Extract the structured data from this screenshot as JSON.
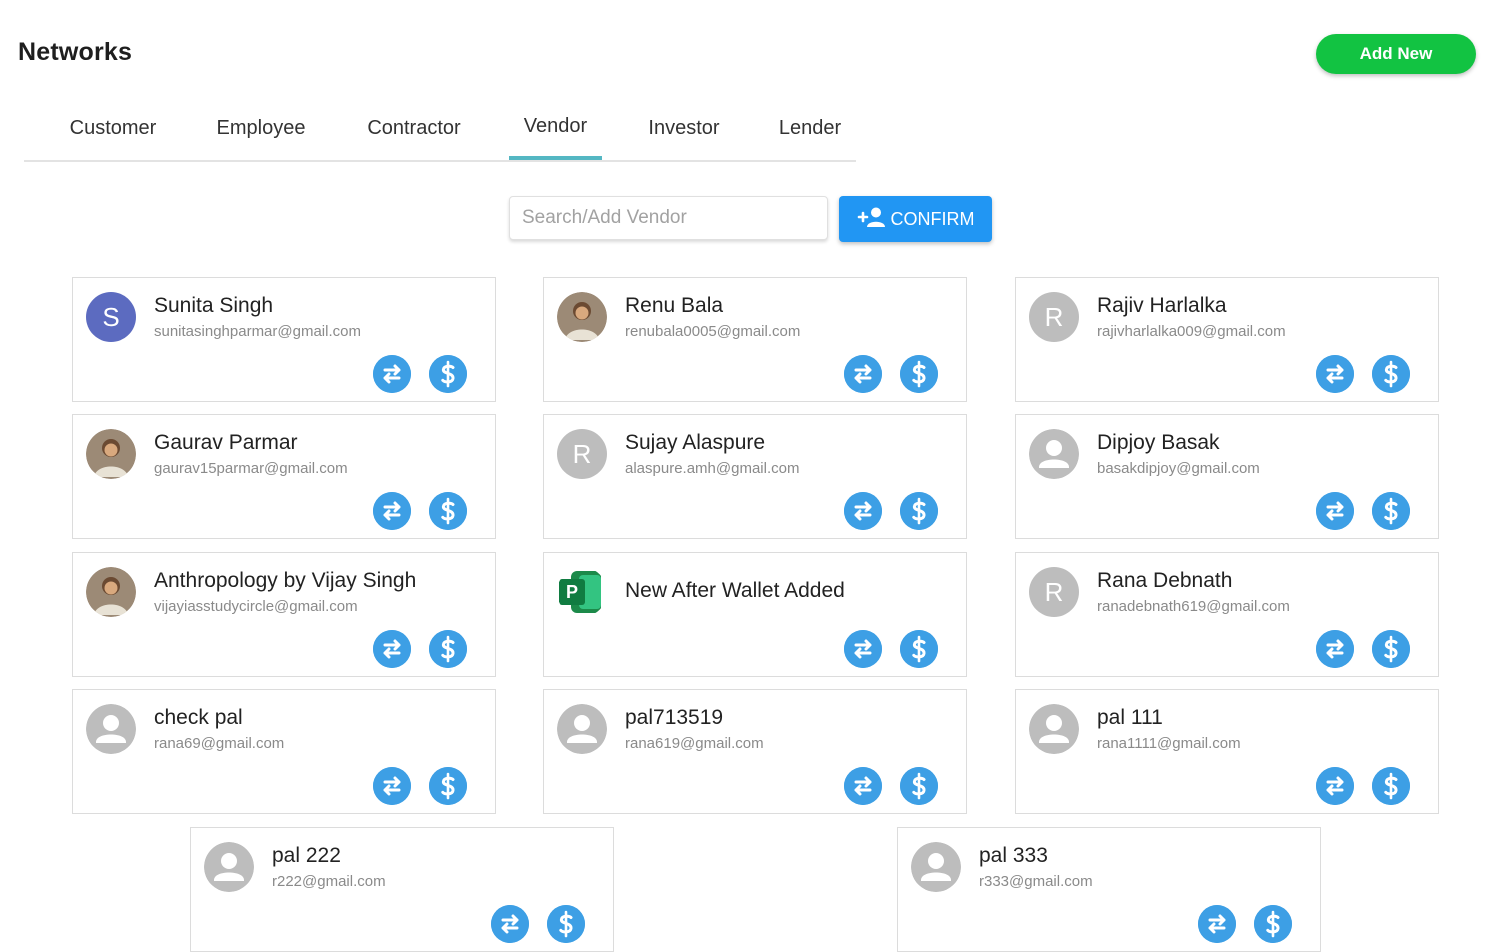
{
  "page": {
    "title": "Networks",
    "add_new_label": "Add New"
  },
  "tabs": [
    {
      "label": "Customer"
    },
    {
      "label": "Employee"
    },
    {
      "label": "Contractor"
    },
    {
      "label": "Vendor",
      "active": true
    },
    {
      "label": "Investor"
    },
    {
      "label": "Lender"
    }
  ],
  "search": {
    "placeholder": "Search/Add Vendor",
    "value": "",
    "confirm_label": "CONFIRM"
  },
  "colors": {
    "accent": "#2196f3",
    "add_new": "#12c342",
    "tab_indicator": "#54b7c3",
    "action": "#3d9fe5"
  },
  "contacts": [
    {
      "name": "Sunita Singh",
      "email": "sunitasinghparmar@gmail.com",
      "avatar": "initial",
      "initial": "S",
      "avatar_color": "#5c6bc0"
    },
    {
      "name": "Renu Bala",
      "email": "renubala0005@gmail.com",
      "avatar": "photo"
    },
    {
      "name": "Rajiv Harlalka",
      "email": "rajivharlalka009@gmail.com",
      "avatar": "initial",
      "initial": "R",
      "avatar_color": "#bdbdbd"
    },
    {
      "name": "Gaurav Parmar",
      "email": "gaurav15parmar@gmail.com",
      "avatar": "photo"
    },
    {
      "name": "Sujay Alaspure",
      "email": "alaspure.amh@gmail.com",
      "avatar": "initial",
      "initial": "R",
      "avatar_color": "#bdbdbd"
    },
    {
      "name": "Dipjoy Basak",
      "email": "basakdipjoy@gmail.com",
      "avatar": "person"
    },
    {
      "name": "Anthropology by Vijay Singh",
      "email": "vijayiasstudycircle@gmail.com",
      "avatar": "photo"
    },
    {
      "name": "New After Wallet Added",
      "email": "",
      "avatar": "logo"
    },
    {
      "name": "Rana Debnath",
      "email": "ranadebnath619@gmail.com",
      "avatar": "initial",
      "initial": "R",
      "avatar_color": "#bdbdbd"
    },
    {
      "name": "check pal",
      "email": "rana69@gmail.com",
      "avatar": "person"
    },
    {
      "name": "pal713519",
      "email": "rana619@gmail.com",
      "avatar": "person"
    },
    {
      "name": "pal 111",
      "email": "rana1111@gmail.com",
      "avatar": "person"
    },
    {
      "name": "pal 222",
      "email": "r222@gmail.com",
      "avatar": "person"
    },
    {
      "name": "pal 333",
      "email": "r333@gmail.com",
      "avatar": "person"
    }
  ]
}
